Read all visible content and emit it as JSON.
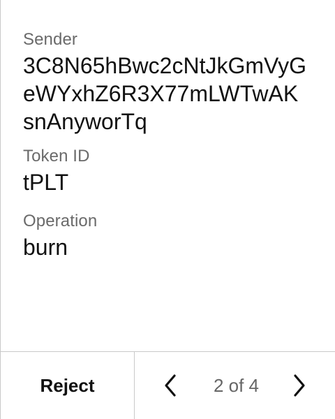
{
  "transaction": {
    "sender": {
      "label": "Sender",
      "value": "3C8N65hBwc2cNtJkGmVyGeWYxhZ6R3X77mLWTwAKsnAnyworTq"
    },
    "token_id": {
      "label": "Token ID",
      "value": "tPLT"
    },
    "operation": {
      "label": "Operation",
      "value": "burn"
    }
  },
  "footer": {
    "reject_label": "Reject",
    "page_indicator": "2 of 4"
  },
  "icons": {
    "previous": "chevron-left-icon",
    "next": "chevron-right-icon"
  },
  "colors": {
    "label_text": "#6a6a6a",
    "value_text": "#111111",
    "divider": "#c9c9c9"
  }
}
